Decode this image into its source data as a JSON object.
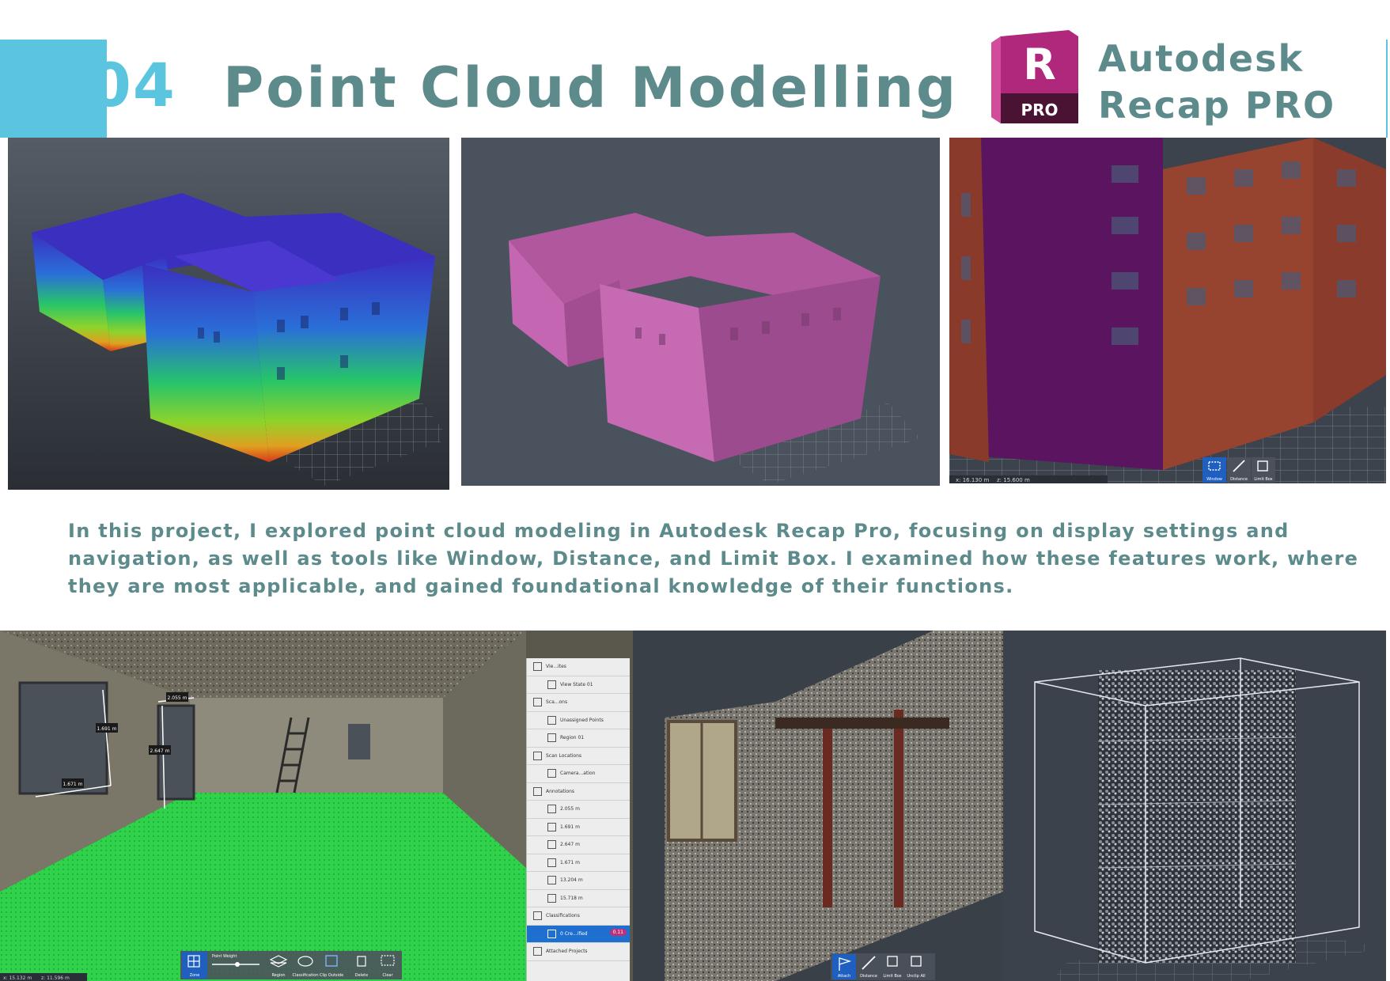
{
  "header": {
    "section_number": "04",
    "title": "Point Cloud Modelling",
    "logo_letter": "R",
    "logo_badge": "PRO",
    "brand_line1": "Autodesk",
    "brand_line2": "Recap PRO"
  },
  "description": {
    "line1": "In this project, I explored point cloud modeling in Autodesk Recap Pro, focusing on display settings and",
    "line2": "navigation, as well as tools like Window, Distance, and Limit Box. I examined how these features work, where",
    "line3": "they are most applicable, and gained foundational knowledge of their functions."
  },
  "colors": {
    "accent_blue": "#5bc4de",
    "heading_teal": "#5d8a8b",
    "logo_magenta": "#b0287c",
    "viewport_bg": "#3f4650"
  },
  "viewport_top_right": {
    "status_left": "x: 16.130 m",
    "status_right": "z: 15.600 m",
    "tools": [
      {
        "label": "Window",
        "icon": "window-select-icon"
      },
      {
        "label": "Distance",
        "icon": "distance-icon"
      },
      {
        "label": "Limit Box",
        "icon": "limit-box-icon"
      }
    ]
  },
  "viewport_bottom_left": {
    "status_left": "x: 15.132 m",
    "status_right": "z: 11.596 m",
    "measurements": [
      "2.055 m",
      "1.691 m",
      "2.647 m",
      "1.671 m"
    ],
    "toolbar": [
      {
        "label": "Zone",
        "icon": "grid-icon"
      },
      {
        "label": "Point Weight",
        "icon": "slider-icon"
      },
      {
        "label": "Region",
        "icon": "layers-icon"
      },
      {
        "label": "Classification",
        "icon": "cloud-icon"
      },
      {
        "label": "Clip Outside",
        "icon": "crop-icon"
      },
      {
        "label": "Delete",
        "icon": "trash-icon"
      },
      {
        "label": "Clear",
        "icon": "clear-selection-icon"
      }
    ],
    "project_tree": [
      {
        "label": "Vie...ites",
        "level": 0,
        "icon": "views-icon"
      },
      {
        "label": "View State 01",
        "level": 1,
        "icon": "view-icon"
      },
      {
        "label": "Sca...ons",
        "level": 0,
        "icon": "scans-icon"
      },
      {
        "label": "Unassigned Points",
        "level": 1,
        "icon": "point-icon"
      },
      {
        "label": "Region 01",
        "level": 1,
        "icon": "point-icon"
      },
      {
        "label": "Scan Locations",
        "level": 0,
        "icon": "scan-location-icon"
      },
      {
        "label": "Camera...ation",
        "level": 1,
        "icon": "camera-icon"
      },
      {
        "label": "Annotations",
        "level": 0,
        "icon": "annotation-icon"
      },
      {
        "label": "2.055 m",
        "level": 1,
        "icon": "measure-icon"
      },
      {
        "label": "1.691 m",
        "level": 1,
        "icon": "measure-icon"
      },
      {
        "label": "2.647 m",
        "level": 1,
        "icon": "measure-icon"
      },
      {
        "label": "1.671 m",
        "level": 1,
        "icon": "measure-icon"
      },
      {
        "label": "13.204 m",
        "level": 1,
        "icon": "measure-icon"
      },
      {
        "label": "15.718 m",
        "level": 1,
        "icon": "measure-icon"
      },
      {
        "label": "Classifications",
        "level": 0,
        "icon": "classification-icon"
      },
      {
        "label": "0 Cre...ified",
        "level": 1,
        "icon": "class-item-icon",
        "selected": true
      },
      {
        "label": "Attached Projects",
        "level": 0,
        "icon": "attached-icon"
      }
    ],
    "tree_badge": "0.11"
  },
  "viewport_bottom_middle": {
    "tools": [
      {
        "label": "Attach",
        "icon": "flag-icon"
      },
      {
        "label": "Distance",
        "icon": "distance-icon"
      },
      {
        "label": "Limit Box",
        "icon": "limit-box-icon"
      },
      {
        "label": "Unclip All",
        "icon": "unclip-icon"
      }
    ]
  }
}
